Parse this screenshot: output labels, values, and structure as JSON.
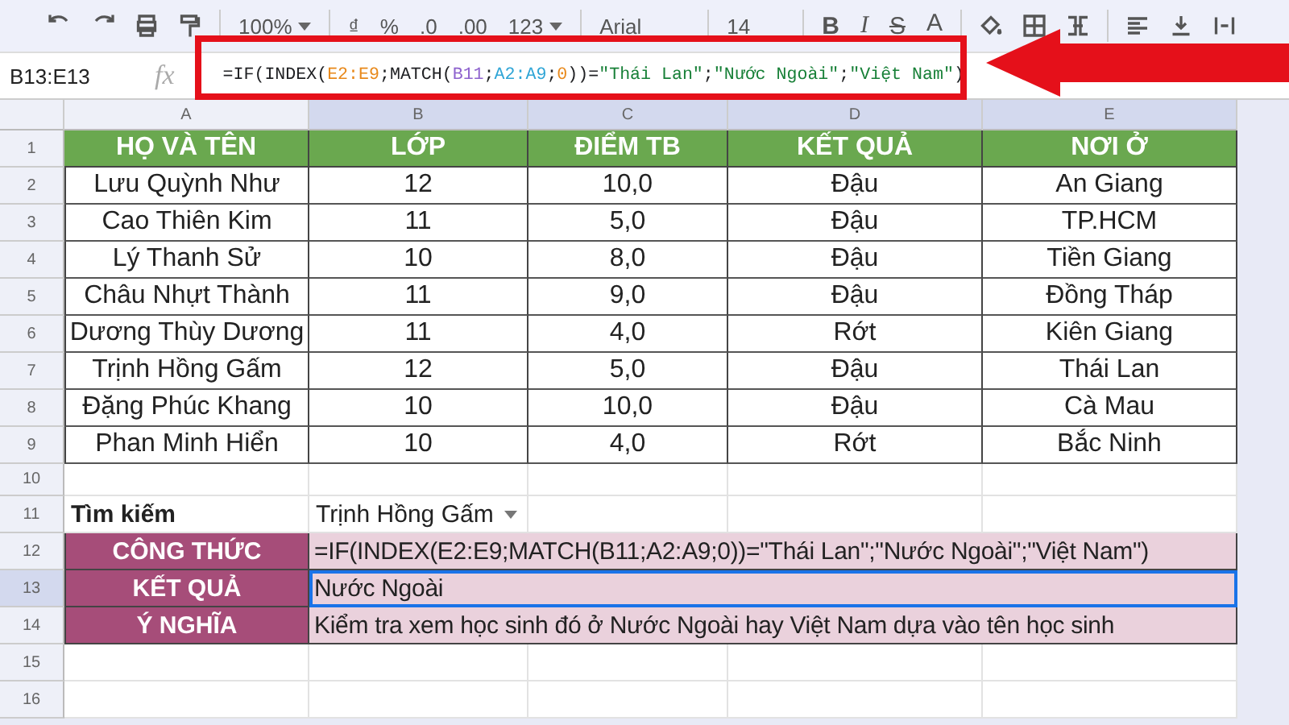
{
  "toolbar": {
    "zoom": "100%",
    "currency": "₫",
    "percent": "%",
    "decimal_less": ".0",
    "decimal_more": ".00",
    "number_format": "123",
    "font": "Arial",
    "font_size": "14",
    "bold": "B",
    "italic": "I",
    "strikethrough": "S",
    "text_color": "A"
  },
  "name_box": "B13:E13",
  "fx": "fx",
  "formula": [
    {
      "text": "=IF(INDEX(",
      "color": "#202124"
    },
    {
      "text": "E2:E9",
      "color": "#e8891b"
    },
    {
      "text": ";MATCH(",
      "color": "#202124"
    },
    {
      "text": "B11",
      "color": "#8e63ce"
    },
    {
      "text": ";",
      "color": "#202124"
    },
    {
      "text": "A2:A9",
      "color": "#2fa5d6"
    },
    {
      "text": ";",
      "color": "#202124"
    },
    {
      "text": "0",
      "color": "#e8891b"
    },
    {
      "text": "))=",
      "color": "#202124"
    },
    {
      "text": "\"Thái Lan\"",
      "color": "#188038"
    },
    {
      "text": ";",
      "color": "#202124"
    },
    {
      "text": "\"Nước Ngoài\"",
      "color": "#188038"
    },
    {
      "text": ";",
      "color": "#202124"
    },
    {
      "text": "\"Việt Nam\"",
      "color": "#188038"
    },
    {
      "text": ")",
      "color": "#202124"
    }
  ],
  "columns": [
    {
      "label": "A",
      "selected": false
    },
    {
      "label": "B",
      "selected": true
    },
    {
      "label": "C",
      "selected": true
    },
    {
      "label": "D",
      "selected": true
    },
    {
      "label": "E",
      "selected": true
    }
  ],
  "rows": [
    {
      "number": "1",
      "kind": "header",
      "selected": false,
      "cells": [
        "HỌ VÀ TÊN",
        "LỚP",
        "ĐIỂM TB",
        "KẾT QUẢ",
        "NƠI Ở"
      ]
    },
    {
      "number": "2",
      "kind": "data",
      "selected": false,
      "cells": [
        "Lưu Quỳnh Như",
        "12",
        "10,0",
        "Đậu",
        "An Giang"
      ]
    },
    {
      "number": "3",
      "kind": "data",
      "selected": false,
      "cells": [
        "Cao Thiên Kim",
        "11",
        "5,0",
        "Đậu",
        "TP.HCM"
      ]
    },
    {
      "number": "4",
      "kind": "data",
      "selected": false,
      "cells": [
        "Lý Thanh Sử",
        "10",
        "8,0",
        "Đậu",
        "Tiền Giang"
      ]
    },
    {
      "number": "5",
      "kind": "data",
      "selected": false,
      "cells": [
        "Châu Nhựt Thành",
        "11",
        "9,0",
        "Đậu",
        "Đồng Tháp"
      ]
    },
    {
      "number": "6",
      "kind": "data",
      "selected": false,
      "cells": [
        "Dương Thùy Dương",
        "11",
        "4,0",
        "Rớt",
        "Kiên Giang"
      ]
    },
    {
      "number": "7",
      "kind": "data",
      "selected": false,
      "cells": [
        "Trịnh Hồng Gấm",
        "12",
        "5,0",
        "Đậu",
        "Thái Lan"
      ]
    },
    {
      "number": "8",
      "kind": "data",
      "selected": false,
      "cells": [
        "Đặng Phúc Khang",
        "10",
        "10,0",
        "Đậu",
        "Cà Mau"
      ]
    },
    {
      "number": "9",
      "kind": "data",
      "selected": false,
      "cells": [
        "Phan Minh Hiển",
        "10",
        "4,0",
        "Rớt",
        "Bắc Ninh"
      ]
    },
    {
      "number": "10",
      "kind": "blank",
      "selected": false,
      "cells": []
    },
    {
      "number": "11",
      "kind": "lookup",
      "selected": false,
      "cells": [
        "Tìm kiếm",
        "Trịnh Hồng Gấm"
      ]
    },
    {
      "number": "12",
      "kind": "summary",
      "selected": false,
      "cells": [
        "CÔNG THỨC",
        "=IF(INDEX(E2:E9;MATCH(B11;A2:A9;0))=\"Thái Lan\";\"Nước Ngoài\";\"Việt Nam\")"
      ]
    },
    {
      "number": "13",
      "kind": "summary",
      "selected": true,
      "cells": [
        "KẾT QUẢ",
        "Nước Ngoài"
      ]
    },
    {
      "number": "14",
      "kind": "summary",
      "selected": false,
      "cells": [
        "Ý NGHĨA",
        "Kiểm tra xem học sinh đó ở Nước Ngoài hay Việt Nam dựa vào tên học sinh"
      ]
    },
    {
      "number": "15",
      "kind": "blank",
      "selected": false,
      "cells": []
    },
    {
      "number": "16",
      "kind": "blank",
      "selected": false,
      "cells": []
    }
  ]
}
